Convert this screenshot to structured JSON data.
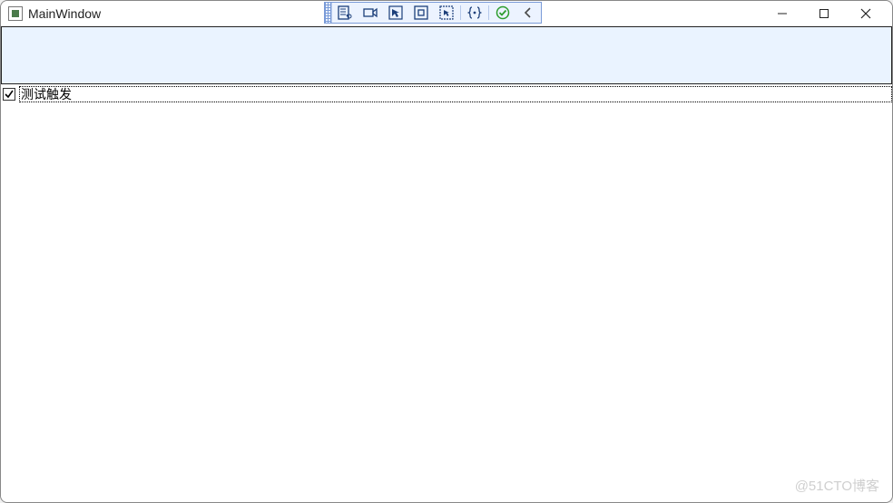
{
  "window": {
    "title": "MainWindow"
  },
  "toolbar": {
    "icons": [
      "live-property-explorer",
      "layout-adorners",
      "select-element",
      "display-layout",
      "track-focus",
      "xaml-binding",
      "hot-reload-success",
      "collapse"
    ]
  },
  "checkbox": {
    "checked": true,
    "label": "测试触发"
  },
  "watermark": "@51CTO博客"
}
